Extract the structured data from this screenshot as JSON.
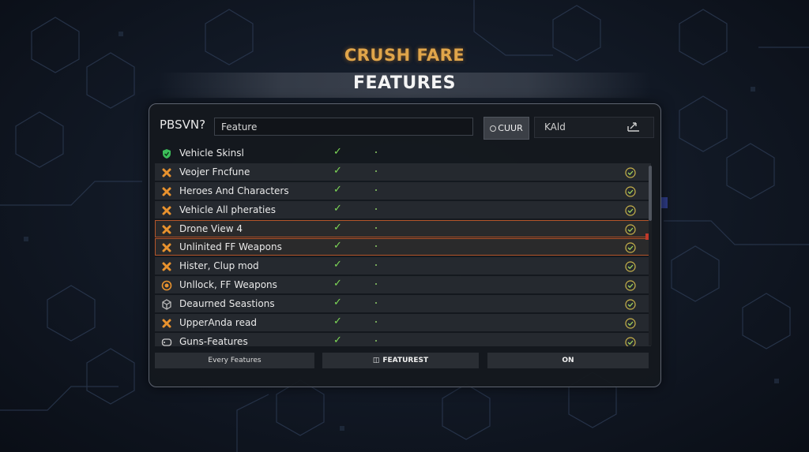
{
  "header": {
    "logo": "CRUSH FARE",
    "title": "FEATURES"
  },
  "toolbar": {
    "brand": "PBSVN?",
    "search_value": "Feature",
    "cuur_label": "CUUR",
    "kaid_label": "KAld"
  },
  "features": [
    {
      "label": "Vehicle Skinsl",
      "icon": "shield-icon",
      "icon_color": "#3cbf5a",
      "status": "check",
      "ok": false
    },
    {
      "label": "Veojer Fncfune",
      "icon": "cross-icon",
      "icon_color": "#e8922e",
      "status": "check",
      "ok": true
    },
    {
      "label": "Heroes And Characters",
      "icon": "cross-icon",
      "icon_color": "#e8922e",
      "status": "check",
      "ok": true
    },
    {
      "label": "Vehicle All pheraties",
      "icon": "cross-icon",
      "icon_color": "#e8922e",
      "status": "check",
      "ok": true
    },
    {
      "label": "Drone View 4",
      "icon": "cross-icon",
      "icon_color": "#e8922e",
      "status": "check",
      "ok": true,
      "selected": true
    },
    {
      "label": "Unlinited FF Weapons",
      "icon": "cross-icon",
      "icon_color": "#e8922e",
      "status": "check",
      "ok": true,
      "selected": true
    },
    {
      "label": "Hister, Clup mod",
      "icon": "cross-icon",
      "icon_color": "#e8922e",
      "status": "check",
      "ok": true
    },
    {
      "label": "Unllock, FF Weapons",
      "icon": "medal-icon",
      "icon_color": "#e8922e",
      "status": "check",
      "ok": true
    },
    {
      "label": "Deaurned Seastions",
      "icon": "cube-icon",
      "icon_color": "#bbbbbb",
      "status": "check",
      "ok": true
    },
    {
      "label": "UpperAnda read",
      "icon": "cross-icon",
      "icon_color": "#e8922e",
      "status": "check",
      "ok": true
    },
    {
      "label": "Guns-Features",
      "icon": "gamepad-icon",
      "icon_color": "#cccccc",
      "status": "check",
      "ok": true
    }
  ],
  "footer": {
    "tab1": "Every Features",
    "tab2": "FEATUREST",
    "tab3": "ON"
  },
  "colors": {
    "accent": "#e0a54a",
    "check": "#7ed957",
    "selected_border": "#b5552a"
  }
}
